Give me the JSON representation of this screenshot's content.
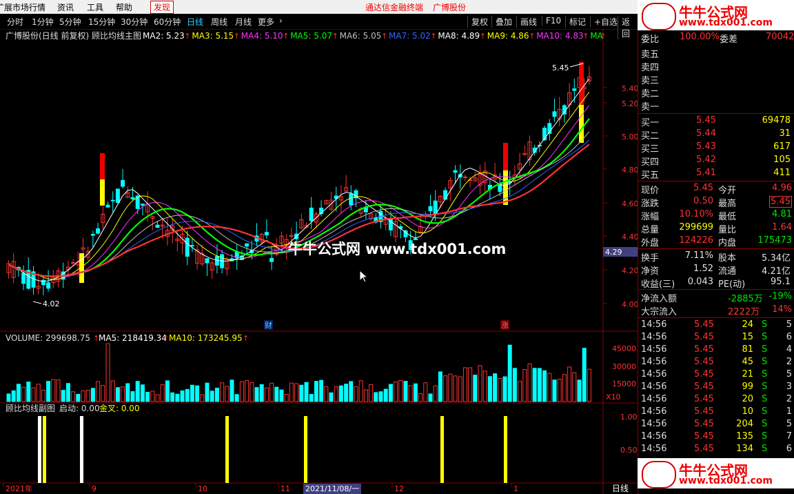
{
  "menu": {
    "items": [
      "扩展市场行情",
      "资讯",
      "工具",
      "帮助"
    ],
    "discover": "发现",
    "app_title": "通达信金融终端",
    "stock_title": "广博股份"
  },
  "toolbar": {
    "periods": [
      "分时",
      "1分钟",
      "5分钟",
      "15分钟",
      "30分钟",
      "60分钟",
      "日线",
      "周线",
      "月线",
      "更多"
    ],
    "active_period": "日线",
    "right_tools": [
      "复权",
      "叠加",
      "画线",
      "F10",
      "标记",
      "+自选",
      "返回"
    ]
  },
  "main_panel": {
    "title": "广博股份(日线 前复权) 顾比均线主图",
    "ma_labels": [
      {
        "text": "MA2: 5.23",
        "color": "#ffffff"
      },
      {
        "text": "MA3: 5.15",
        "color": "#ffff00"
      },
      {
        "text": "MA4: 5.10",
        "color": "#ff33ff"
      },
      {
        "text": "MA5: 5.07",
        "color": "#00ff00"
      },
      {
        "text": "MA6: 5.05",
        "color": "#c0c0c0"
      },
      {
        "text": "MA7: 5.02",
        "color": "#3366ff"
      },
      {
        "text": "MA8: 4.89",
        "color": "#ffffff"
      },
      {
        "text": "MA9: 4.86",
        "color": "#ffff00"
      },
      {
        "text": "MA10: 4.83",
        "color": "#ff33ff"
      },
      {
        "text": "MA",
        "color": "#00ff00"
      }
    ],
    "high_label": "5.45",
    "low_label": "4.02",
    "event_cai": "财",
    "event_zhang": "涨",
    "price_axis": [
      "5.40",
      "5.20",
      "5.00",
      "4.80",
      "4.60",
      "4.40",
      "4.20",
      "4.00"
    ],
    "current_price_tag": "4.29"
  },
  "volume_panel": {
    "title": "VOLUME: 299698.75",
    "ma5": "MA5: 218419.34",
    "ma10": "MA10: 173245.95",
    "axis": [
      "45000",
      "30000",
      "15000"
    ],
    "unit": "X10"
  },
  "sub_panel": {
    "title": "顾比均线副图",
    "qidong": "启动: 0.00",
    "jincha": "金叉: 0.00",
    "axis": [
      "1.00",
      "0.50"
    ]
  },
  "date_axis": {
    "labels": [
      "2021年",
      "9",
      "10",
      "11",
      "2021/11/08/一",
      "12",
      "1"
    ],
    "period": "日线"
  },
  "watermark": {
    "center": "牛牛公式网 www.tdx001.com",
    "brand": "牛牛公式网",
    "site": "www.tdx001.com"
  },
  "quote": {
    "partial_top": [
      "委比",
      "100.00%",
      "委差",
      "70042"
    ],
    "sell": [
      "卖五",
      "卖四",
      "卖三",
      "卖二",
      "卖一"
    ],
    "buy": [
      {
        "label": "买一",
        "price": "5.45",
        "vol": "69478"
      },
      {
        "label": "买二",
        "price": "5.44",
        "vol": "31"
      },
      {
        "label": "买三",
        "price": "5.43",
        "vol": "617"
      },
      {
        "label": "买四",
        "price": "5.42",
        "vol": "105"
      },
      {
        "label": "买五",
        "price": "5.41",
        "vol": "411"
      }
    ],
    "stats": [
      {
        "l1": "现价",
        "v1": "5.45",
        "c1": "red",
        "l2": "今开",
        "v2": "4.96",
        "c2": "red"
      },
      {
        "l1": "涨跌",
        "v1": "0.50",
        "c1": "red",
        "l2": "最高",
        "v2": "5.45",
        "c2": "red"
      },
      {
        "l1": "涨幅",
        "v1": "10.10%",
        "c1": "red",
        "l2": "最低",
        "v2": "4.81",
        "c2": "green"
      },
      {
        "l1": "总量",
        "v1": "299699",
        "c1": "yellow",
        "l2": "量比",
        "v2": "1.64",
        "c2": "red"
      },
      {
        "l1": "外盘",
        "v1": "124226",
        "c1": "red",
        "l2": "内盘",
        "v2": "175473",
        "c2": "green"
      }
    ],
    "stats2": [
      {
        "l1": "换手",
        "v1": "7.11%",
        "c1": "white",
        "l2": "股本",
        "v2": "5.34亿",
        "c2": "white"
      },
      {
        "l1": "净资",
        "v1": "1.52",
        "c1": "white",
        "l2": "流通",
        "v2": "4.21亿",
        "c2": "white"
      },
      {
        "l1": "收益(三)",
        "v1": "0.043",
        "c1": "white",
        "l2": "PE(动)",
        "v2": "95.1",
        "c2": "white"
      }
    ],
    "flow": [
      {
        "label": "净流入额",
        "v": "-2885万",
        "c": "green",
        "pct": "-19%",
        "pc": "green"
      },
      {
        "label": "大宗流入",
        "v": "2222万",
        "c": "red",
        "pct": "14%",
        "pc": "red"
      }
    ],
    "ticks": [
      {
        "t": "14:56",
        "p": "5.45",
        "v": "24",
        "s": "S",
        "n": "5"
      },
      {
        "t": "14:56",
        "p": "5.45",
        "v": "15",
        "s": "S",
        "n": "6"
      },
      {
        "t": "14:56",
        "p": "5.45",
        "v": "81",
        "s": "S",
        "n": "4"
      },
      {
        "t": "14:56",
        "p": "5.45",
        "v": "45",
        "s": "S",
        "n": "2"
      },
      {
        "t": "14:56",
        "p": "5.45",
        "v": "21",
        "s": "S",
        "n": "5"
      },
      {
        "t": "14:56",
        "p": "5.45",
        "v": "99",
        "s": "S",
        "n": "3"
      },
      {
        "t": "14:56",
        "p": "5.45",
        "v": "20",
        "s": "S",
        "n": "2"
      },
      {
        "t": "14:56",
        "p": "5.45",
        "v": "10",
        "s": "S",
        "n": "1"
      },
      {
        "t": "14:56",
        "p": "5.45",
        "v": "204",
        "s": "S",
        "n": "5"
      },
      {
        "t": "14:56",
        "p": "5.45",
        "v": "135",
        "s": "S",
        "n": "7"
      },
      {
        "t": "14:56",
        "p": "5.45",
        "v": "134",
        "s": "S",
        "n": "6"
      }
    ]
  }
}
